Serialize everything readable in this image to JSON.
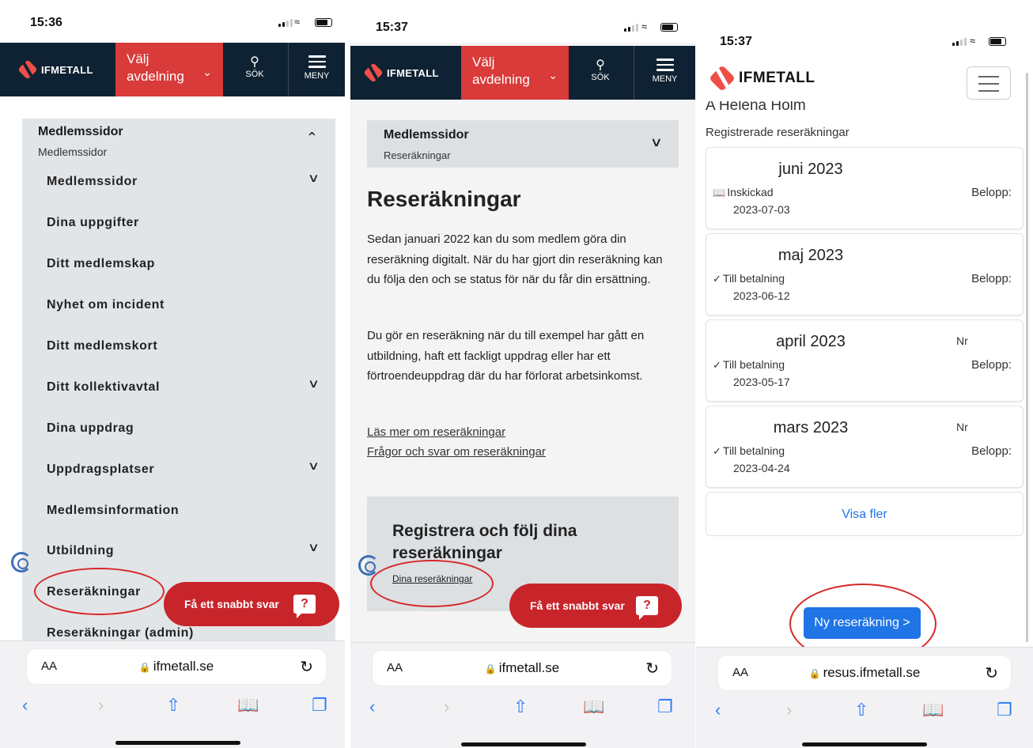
{
  "screen1": {
    "time": "15:36",
    "brand": "IFMETALL",
    "department_btn": "Välj avdelning",
    "search_label": "SÖK",
    "menu_label": "MENY",
    "menu_header_title": "Medlemssidor",
    "menu_header_sub": "Medlemssidor",
    "menu_items": [
      "Medlemssidor",
      "Dina uppgifter",
      "Ditt medlemskap",
      "Nyhet om incident",
      "Ditt medlemskort",
      "Ditt kollektivavtal",
      "Dina uppdrag",
      "Uppdragsplatser",
      "Medlemsinformation",
      "Utbildning",
      "Reseräkningar",
      "Reseräkningar (admin)"
    ],
    "quick_answer": "Få ett snabbt svar",
    "url_aa": "AA",
    "url": "ifmetall.se"
  },
  "screen2": {
    "time": "15:37",
    "brand": "IFMETALL",
    "department_btn": "Välj avdelning",
    "search_label": "SÖK",
    "menu_label": "MENY",
    "breadcrumb_title": "Medlemssidor",
    "breadcrumb_sub": "Reseräkningar",
    "heading": "Reseräkningar",
    "para1": "Sedan januari 2022 kan du som medlem göra din reseräkning digitalt. När du har gjort din reseräkning kan du följa den och se status för när du får din ersättning.",
    "para2": "Du gör en reseräkning när du till exempel har gått en utbildning, haft ett fackligt uppdrag eller har ett förtroendeuppdrag där du har förlorat arbetsinkomst.",
    "link1": "Läs mer om reseräkningar",
    "link2": "Frågor och svar om reseräkningar",
    "register_title": "Registrera och följ dina reseräkningar",
    "register_link": "Dina reseräkningar",
    "quick_answer": "Få ett snabbt svar",
    "url_aa": "AA",
    "url": "ifmetall.se"
  },
  "screen3": {
    "time": "15:37",
    "brand": "IFMETALL",
    "cut_name": "A Helena Holm",
    "subtitle": "Registrerade reseräkningar",
    "amount_label": "Belopp:",
    "cards": [
      {
        "month": "juni 2023",
        "status": "Inskickad",
        "status_icon": "book-icon",
        "date": "2023-07-03",
        "nr": ""
      },
      {
        "month": "maj 2023",
        "status": "Till betalning",
        "status_icon": "check-icon",
        "date": "2023-06-12",
        "nr": ""
      },
      {
        "month": "april 2023",
        "status": "Till betalning",
        "status_icon": "check-icon",
        "date": "2023-05-17",
        "nr": "Nr"
      },
      {
        "month": "mars 2023",
        "status": "Till betalning",
        "status_icon": "check-icon",
        "date": "2023-04-24",
        "nr": "Nr"
      }
    ],
    "show_more": "Visa fler",
    "new_button": "Ny reseräkning >",
    "url_aa": "AA",
    "url": "resus.ifmetall.se"
  },
  "colors": {
    "navy": "#0f2233",
    "brand_red": "#d93a3a",
    "accent_blue": "#1f74e6",
    "highlight_red": "#d62828"
  }
}
